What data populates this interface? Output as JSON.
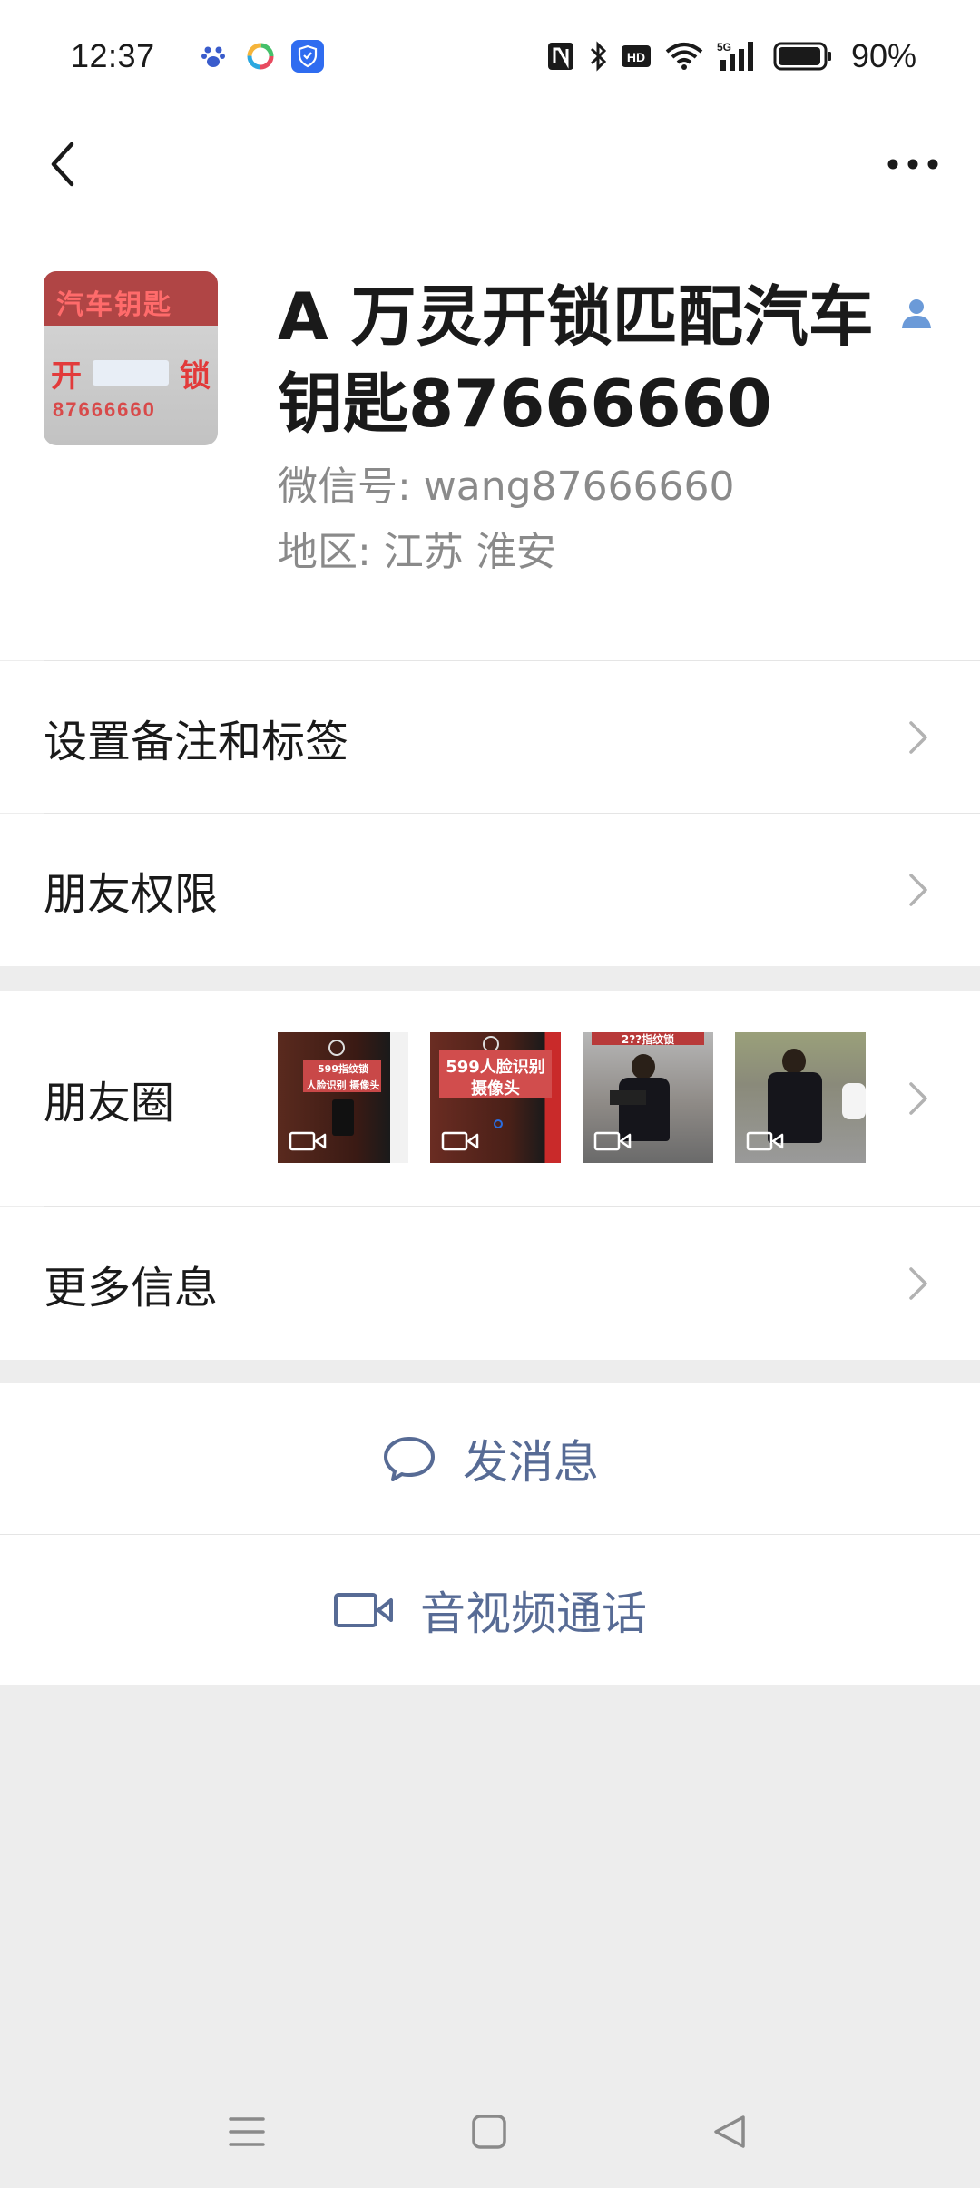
{
  "status_bar": {
    "time": "12:37",
    "app_icons": [
      "baidu-paw-icon",
      "color-circle-app-icon",
      "blue-shield-app-icon"
    ],
    "indicators": [
      "nfc-icon",
      "bluetooth-icon",
      "hd-icon",
      "wifi-icon",
      "5g-signal-icon",
      "battery-icon"
    ],
    "battery_percent": "90%"
  },
  "nav": {
    "back_icon": "chevron-left-icon",
    "more_icon": "more-dots-icon"
  },
  "profile": {
    "avatar_alt": {
      "top_text": "汽车钥匙",
      "left_char": "开",
      "right_char": "锁",
      "number": "87666660"
    },
    "name": "A  万灵开锁匹配汽车钥匙87666660",
    "badge_icon": "contact-person-icon",
    "wechat_id": "微信号: wang87666660",
    "region": "地区: 江苏  淮安"
  },
  "cells": {
    "remark_label": "设置备注和标签",
    "permissions_label": "朋友权限",
    "moments_label": "朋友圈",
    "more_info_label": "更多信息"
  },
  "moments_thumbs": [
    {
      "caption_line1": "599指纹锁",
      "caption_line2": "人脸识别 摄像头"
    },
    {
      "caption_line1": "599人脸识别",
      "caption_line2": "摄像头"
    },
    {
      "caption_line1": "2??指纹锁",
      "caption_line2": ""
    },
    {
      "caption_line1": "",
      "caption_line2": ""
    }
  ],
  "actions": {
    "message_label": "发消息",
    "call_label": "音视频通话"
  },
  "colors": {
    "link_blue": "#576b95",
    "background": "#ededed"
  }
}
